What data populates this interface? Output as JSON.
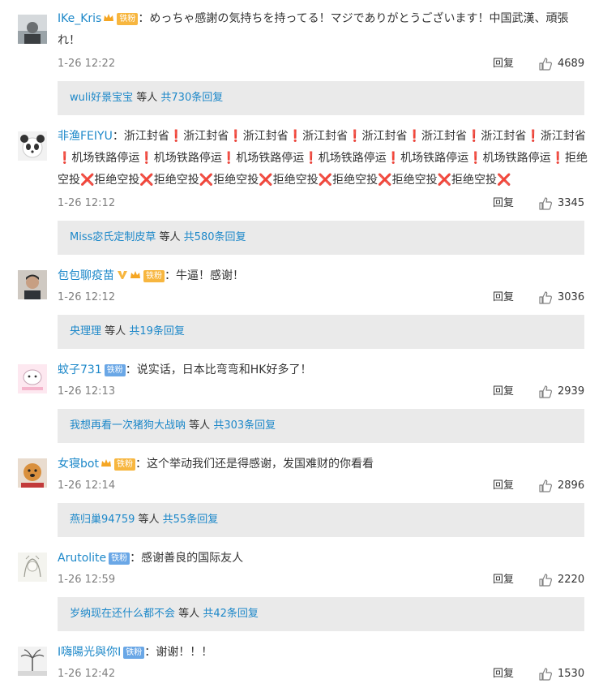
{
  "colors": {
    "name_orange": "#eb7350",
    "link_blue": "#1d88c9",
    "reply_box_bg": "#eaeaea",
    "badge_orange": "#f7b63f",
    "badge_blue": "#6aa7e6"
  },
  "labels": {
    "reply": "回复",
    "badge_tiefen": "铁粉",
    "others": "等人",
    "colon": "："
  },
  "comments": [
    {
      "username": "IKe_Kris",
      "badge": "铁粉",
      "text": "めっちゃ感謝の気持ちを持ってる！マジでありがとうございます！中国武漢、頑張れ！",
      "time": "1-26 12:22",
      "likes": "4689",
      "reply_user": "wuli好景宝宝",
      "reply_total": "共730条回复",
      "avatar_icon": "avatar-photo-icon"
    },
    {
      "username": "非渔FEIYU",
      "text": "浙江封省❗浙江封省❗浙江封省❗浙江封省❗浙江封省❗浙江封省❗浙江封省❗浙江封省❗机场铁路停运❗机场铁路停运❗机场铁路停运❗机场铁路停运❗机场铁路停运❗机场铁路停运❗拒绝空投❌拒绝空投❌拒绝空投❌拒绝空投❌拒绝空投❌拒绝空投❌拒绝空投❌拒绝空投❌",
      "time": "1-26 12:12",
      "likes": "3345",
      "reply_user": "Miss宓氏定制皮草",
      "reply_total": "共580条回复",
      "avatar_icon": "panda-avatar-icon"
    },
    {
      "username": "包包聊疫苗",
      "badge": "铁粉",
      "text": "牛逼！感谢！",
      "time": "1-26 12:12",
      "likes": "3036",
      "reply_user": "央理理",
      "reply_total": "共19条回复",
      "avatar_icon": "avatar-photo-icon"
    },
    {
      "username": "蚊子731",
      "badge": "铁粉",
      "text": "说实话，日本比弯弯和HK好多了！",
      "time": "1-26 12:13",
      "likes": "2939",
      "reply_user": "我想再看一次猪狗大战呐",
      "reply_total": "共303条回复",
      "avatar_icon": "cartoon-avatar-icon"
    },
    {
      "username": "女寝bot",
      "badge": "铁粉",
      "text": "这个举动我们还是得感谢，发国难财的你看看",
      "time": "1-26 12:14",
      "likes": "2896",
      "reply_user": "燕归巢94759",
      "reply_total": "共55条回复",
      "avatar_icon": "dog-avatar-icon"
    },
    {
      "username": "Arutolite",
      "badge": "铁粉",
      "text": "感谢善良的国际友人",
      "time": "1-26 12:59",
      "likes": "2220",
      "reply_user": "岁纳现在还什么都不会",
      "reply_total": "共42条回复",
      "avatar_icon": "sketch-avatar-icon"
    },
    {
      "username": "I嗨陽光與你I",
      "badge": "铁粉",
      "text": "谢谢！！！",
      "time": "1-26 12:42",
      "likes": "1530",
      "avatar_icon": "palm-avatar-icon"
    }
  ]
}
